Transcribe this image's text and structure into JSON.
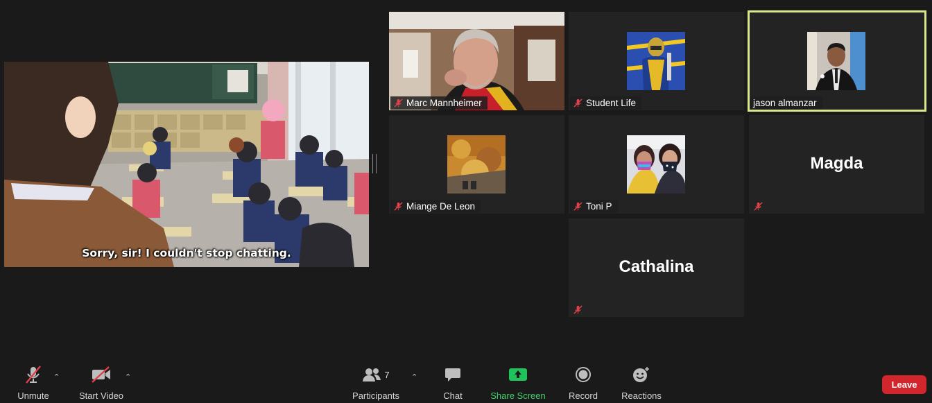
{
  "share": {
    "subtitle": "Sorry, sir! I couldn't stop chatting."
  },
  "participants": [
    {
      "name": "Marc Mannheimer",
      "muted": true
    },
    {
      "name": "Student Life",
      "muted": true
    },
    {
      "name": "jason almanzar",
      "muted": false,
      "active_speaker": true
    },
    {
      "name": "Miange De Leon",
      "muted": true
    },
    {
      "name": "Toni P",
      "muted": true
    },
    {
      "name": "Magda",
      "muted": true
    },
    {
      "name": "Cathalina",
      "muted": true
    }
  ],
  "toolbar": {
    "unmute": "Unmute",
    "start_video": "Start Video",
    "participants": "Participants",
    "participants_count": "7",
    "chat": "Chat",
    "share_screen": "Share Screen",
    "record": "Record",
    "reactions": "Reactions",
    "leave": "Leave"
  },
  "colors": {
    "background": "#1a1a1a",
    "tile": "#232323",
    "active_speaker_border": "#d6e98b",
    "share_green": "#1fc35b",
    "leave_red": "#d1262b",
    "mute_red": "#e0404a"
  }
}
